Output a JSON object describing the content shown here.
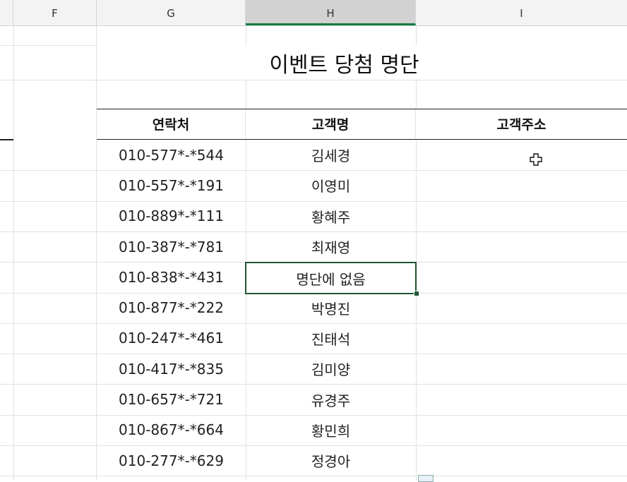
{
  "columns": [
    "F",
    "G",
    "H",
    "I"
  ],
  "title": "이벤트 당첨 명단",
  "table": {
    "headers": [
      "연락처",
      "고객명",
      "고객주소"
    ],
    "rows": [
      {
        "phone": "010-577*-*544",
        "name": "김세경"
      },
      {
        "phone": "010-557*-*191",
        "name": "이영미"
      },
      {
        "phone": "010-889*-*111",
        "name": "황혜주"
      },
      {
        "phone": "010-387*-*781",
        "name": "최재영"
      },
      {
        "phone": "010-838*-*431",
        "name": "명단에 없음"
      },
      {
        "phone": "010-877*-*222",
        "name": "박명진"
      },
      {
        "phone": "010-247*-*461",
        "name": "진태석"
      },
      {
        "phone": "010-417*-*835",
        "name": "김미양"
      },
      {
        "phone": "010-657*-*721",
        "name": "유경주"
      },
      {
        "phone": "010-867*-*664",
        "name": "황민희"
      },
      {
        "phone": "010-277*-*629",
        "name": "정경아"
      }
    ]
  },
  "selection": {
    "column": "H"
  },
  "colors": {
    "selection_border": "#1e5631",
    "table_border": "#222222",
    "gridline": "#e1e1e1"
  }
}
